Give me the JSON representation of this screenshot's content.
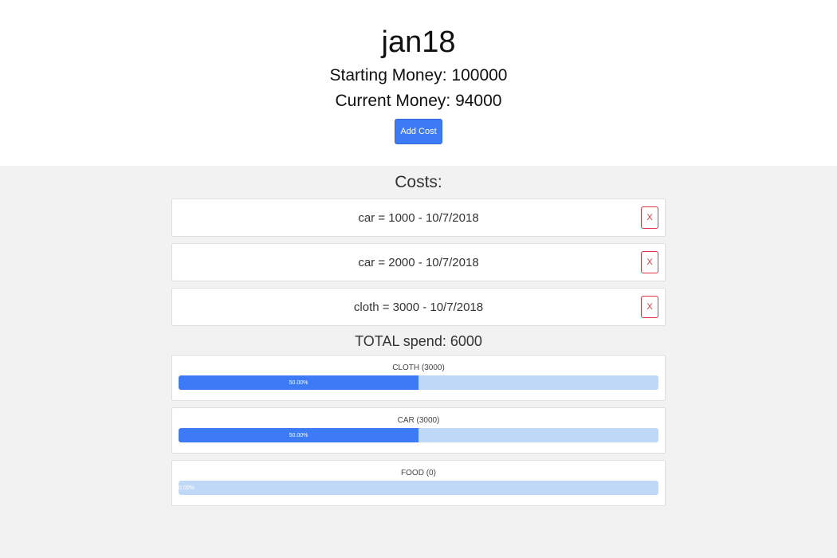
{
  "header": {
    "title": "jan18",
    "starting_money": "Starting Money: 100000",
    "current_money": "Current Money: 94000",
    "add_cost_label": "Add Cost"
  },
  "costs": {
    "heading": "Costs:",
    "remove_label": "X",
    "items": [
      {
        "text": "car = 1000 - 10/7/2018"
      },
      {
        "text": "car = 2000 - 10/7/2018"
      },
      {
        "text": "cloth = 3000 - 10/7/2018"
      }
    ]
  },
  "total_spend": "TOTAL spend: 6000",
  "categories": [
    {
      "label": "CLOTH (3000)",
      "percent_text": "50.00%",
      "percent": 50
    },
    {
      "label": "CAR (3000)",
      "percent_text": "50.00%",
      "percent": 50
    },
    {
      "label": "FOOD (0)",
      "percent_text": "0.00%",
      "percent": 0
    }
  ],
  "colors": {
    "primary": "#3d7af6",
    "progress_track": "#bfd8f7",
    "danger": "#dc3545",
    "content_bg": "#f2f2f2"
  }
}
